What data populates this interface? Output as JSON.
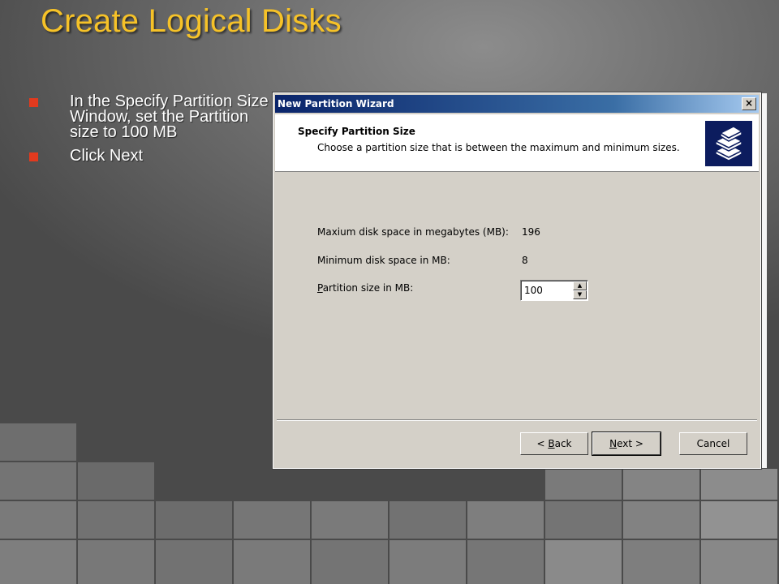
{
  "slide": {
    "title": "Create Logical Disks",
    "bullets": [
      "In the Specify Partition Size Window, set the Partition size to 100 MB",
      "Click Next"
    ],
    "bullet_color": "#e23a1e",
    "title_color": "#f6c228"
  },
  "dialog": {
    "title": "New Partition Wizard",
    "close_glyph": "×",
    "header": {
      "title": "Specify Partition Size",
      "subtitle": "Choose a partition size that is between the maximum and minimum sizes.",
      "icon": "disk-stack-icon"
    },
    "fields": {
      "max_label": "Maxium disk space in megabytes (MB):",
      "max_value": "196",
      "min_label": "Minimum disk space in MB:",
      "min_value": "8",
      "size_label_mnemonic": "P",
      "size_label_rest": "artition size in MB:",
      "size_value": "100"
    },
    "buttons": {
      "back_prefix": "< ",
      "back_mnemonic": "B",
      "back_rest": "ack",
      "next_mnemonic": "N",
      "next_rest": "ext >",
      "cancel": "Cancel"
    }
  }
}
